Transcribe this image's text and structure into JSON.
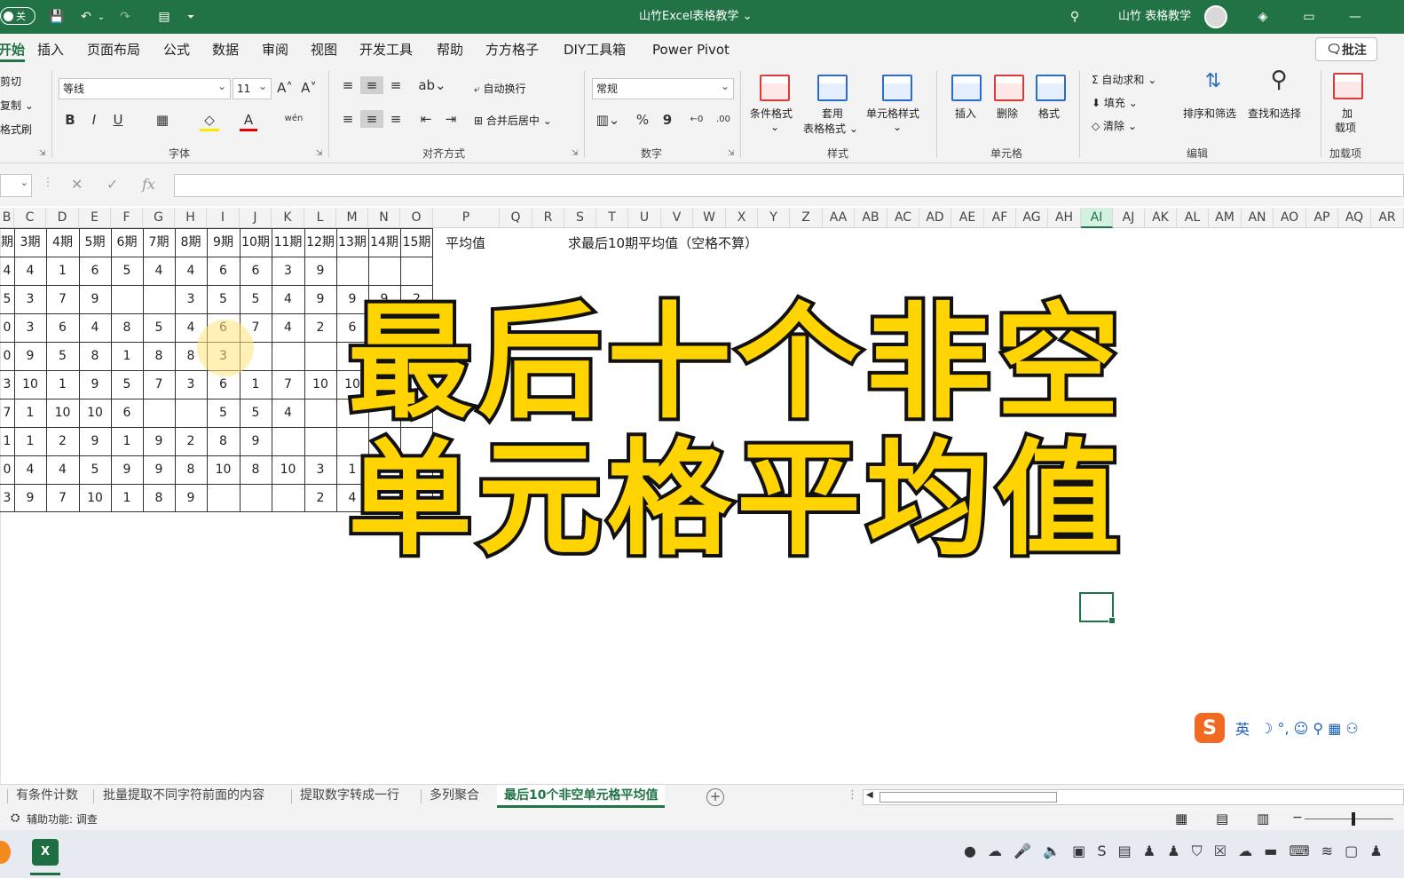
{
  "titlebar": {
    "autosave_label": "关",
    "title": "山竹Excel表格教学 ⌄",
    "user_name": "山竹 表格教学"
  },
  "tabs": [
    "开始",
    "插入",
    "页面布局",
    "公式",
    "数据",
    "审阅",
    "视图",
    "开发工具",
    "帮助",
    "方方格子",
    "DIY工具箱",
    "Power Pivot"
  ],
  "comment_button": "批注",
  "ribbon": {
    "clipboard": {
      "cut": "剪切",
      "copy": "复制 ⌄",
      "format_painter": "格式刷"
    },
    "font": {
      "name": "等线",
      "size": "11",
      "grow": "A˄",
      "shrink": "A˅",
      "bold": "B",
      "italic": "I",
      "underline": "U",
      "group_label": "字体"
    },
    "alignment": {
      "wrap_text": "自动换行",
      "merge_center": "合并后居中",
      "group_label": "对齐方式"
    },
    "number": {
      "format": "常规",
      "group_label": "数字",
      "percent": "%",
      "comma": "9"
    },
    "styles": {
      "conditional": "条件格式",
      "table_format_1": "套用",
      "table_format_2": "表格格式 ⌄",
      "cell_styles": "单元格样式",
      "group_label": "样式"
    },
    "cells": {
      "insert": "插入",
      "delete": "删除",
      "format": "格式",
      "group_label": "单元格"
    },
    "editing": {
      "autosum": "自动求和 ⌄",
      "fill": "填充 ⌄",
      "clear": "清除 ⌄",
      "sort_filter": "排序和筛选",
      "find_select": "查找和选择",
      "group_label": "编辑"
    },
    "addins": {
      "label_1": "加",
      "label_2": "载项",
      "group_label": "加载项"
    }
  },
  "formula_bar": {
    "fx": "fx",
    "cancel": "✕",
    "enter": "✓"
  },
  "columns": [
    "B",
    "C",
    "D",
    "E",
    "F",
    "G",
    "H",
    "I",
    "J",
    "K",
    "L",
    "M",
    "N",
    "O",
    "P",
    "Q",
    "R",
    "S",
    "T",
    "U",
    "V",
    "W",
    "X",
    "Y",
    "Z",
    "AA",
    "AB",
    "AC",
    "AD",
    "AE",
    "AF",
    "AG",
    "AH",
    "AI",
    "AJ",
    "AK",
    "AL",
    "AM",
    "AN",
    "AO",
    "AP",
    "AQ",
    "AR"
  ],
  "selected_column": "AI",
  "headers": [
    "期",
    "3期",
    "4期",
    "5期",
    "6期",
    "7期",
    "8期",
    "9期",
    "10期",
    "11期",
    "12期",
    "13期",
    "14期",
    "15期"
  ],
  "avg_header": "平均值",
  "task_note": "求最后10期平均值（空格不算）",
  "rows": [
    [
      "4",
      "4",
      "1",
      "6",
      "5",
      "4",
      "4",
      "6",
      "6",
      "3",
      "9",
      "",
      "",
      ""
    ],
    [
      "5",
      "3",
      "7",
      "9",
      "",
      "",
      "3",
      "5",
      "5",
      "4",
      "9",
      "9",
      "9",
      "2"
    ],
    [
      "0",
      "3",
      "6",
      "4",
      "8",
      "5",
      "4",
      "6",
      "7",
      "4",
      "2",
      "6",
      "",
      ""
    ],
    [
      "0",
      "9",
      "5",
      "8",
      "1",
      "8",
      "8",
      "3",
      "",
      "",
      "",
      "1",
      "",
      ""
    ],
    [
      "3",
      "10",
      "1",
      "9",
      "5",
      "7",
      "3",
      "6",
      "1",
      "7",
      "10",
      "10",
      "",
      ""
    ],
    [
      "7",
      "1",
      "10",
      "10",
      "6",
      "",
      "",
      "5",
      "5",
      "4",
      "",
      "",
      "",
      ""
    ],
    [
      "1",
      "1",
      "2",
      "9",
      "1",
      "9",
      "2",
      "8",
      "9",
      "",
      "",
      "",
      "",
      ""
    ],
    [
      "0",
      "4",
      "4",
      "5",
      "9",
      "9",
      "8",
      "10",
      "8",
      "10",
      "3",
      "1",
      "",
      ""
    ],
    [
      "3",
      "9",
      "7",
      "10",
      "1",
      "8",
      "9",
      "",
      "",
      "",
      "2",
      "4",
      "",
      ""
    ]
  ],
  "overlay": {
    "line1": "最后十个非空",
    "line2": "单元格平均值"
  },
  "ime": {
    "lang": "英",
    "icons": "☽ °, ☺ ⚲ ▦ ⚇"
  },
  "sheet_tabs": [
    "有条件计数",
    "批量提取不同字符前面的内容",
    "提取数字转成一行",
    "多列聚合",
    "最后10个非空单元格平均值"
  ],
  "active_sheet": "最后10个非空单元格平均值",
  "status": {
    "accessibility": "辅助功能: 调查"
  },
  "taskbar": {
    "tray": "● ☁ 🎤 🔈 ▣ S ▤   ♟ ♟ ⛉ ☒ ☁ ▬ ⌨ ≋ ▢ ♟"
  }
}
